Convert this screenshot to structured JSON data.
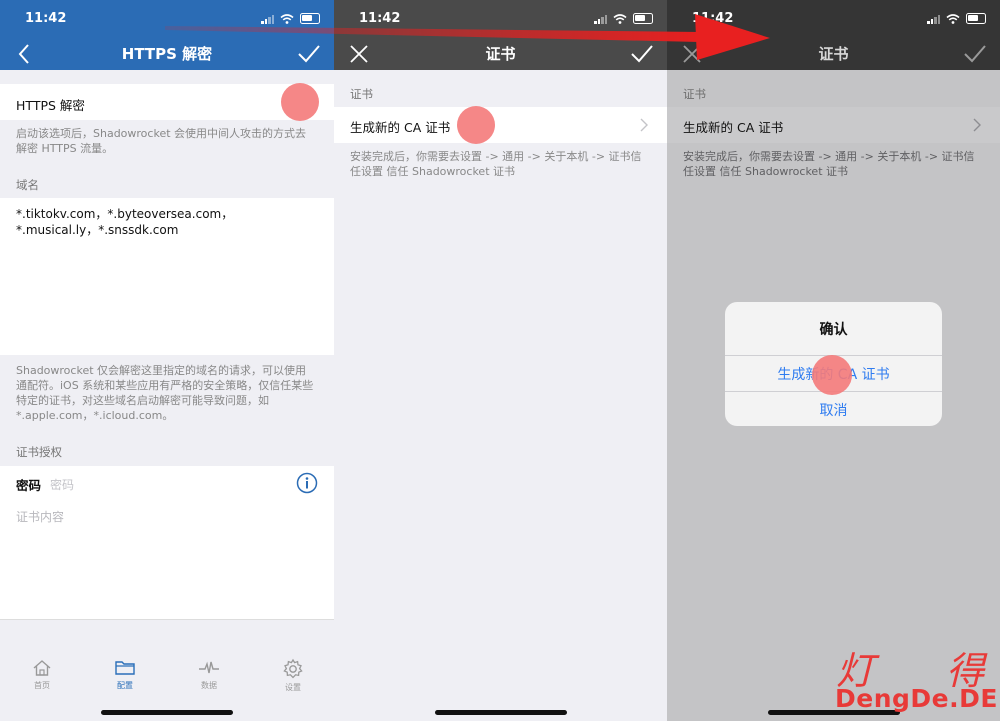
{
  "status": {
    "time_1": "11:42",
    "time_2": "11:42",
    "time_3": "11:42"
  },
  "panel1": {
    "nav_title": "HTTPS 解密",
    "https_label": "HTTPS 解密",
    "https_desc": "启动该选项后，Shadowrocket 会使用中间人攻击的方式去解密 HTTPS 流量。",
    "domain_section": "域名",
    "domain_value": "*.tiktokv.com，*.byteoversea.com，*.musical.ly，*.snssdk.com",
    "domain_note": "Shadowrocket 仅会解密这里指定的域名的请求，可以使用通配符。iOS 系统和某些应用有严格的安全策略，仅信任某些特定的证书，对这些域名启动解密可能导致问题，如 *.apple.com，*.icloud.com。",
    "cert_auth_section": "证书授权",
    "password_label": "密码",
    "password_placeholder": "密码",
    "cert_content_placeholder": "证书内容",
    "tabs": [
      {
        "label": "首页",
        "icon": "home-icon"
      },
      {
        "label": "配置",
        "icon": "folder-icon"
      },
      {
        "label": "数据",
        "icon": "pulse-icon"
      },
      {
        "label": "设置",
        "icon": "gear-icon"
      }
    ]
  },
  "panel2": {
    "nav_title": "证书",
    "section": "证书",
    "generate_label": "生成新的 CA 证书",
    "install_note": "安装完成后，你需要去设置 -> 通用 -> 关于本机 -> 证书信任设置 信任 Shadowrocket 证书"
  },
  "panel3": {
    "nav_title": "证书",
    "section": "证书",
    "generate_label": "生成新的 CA 证书",
    "install_note": "安装完成后，你需要去设置 -> 通用 -> 关于本机 -> 证书信任设置 信任 Shadowrocket 证书",
    "alert": {
      "title": "确认",
      "confirm_label": "生成新的 CA 证书",
      "cancel_label": "取消"
    }
  },
  "watermark": {
    "chinese": "灯 得",
    "domain": "DengDe.DE"
  },
  "colors": {
    "nav_blue": "#2b6cb5",
    "nav_dark": "#4a4a4a",
    "nav_dim": "#353535",
    "highlight": "#f47a7a",
    "watermark": "#e83a38",
    "link_blue": "#2f7cf0"
  }
}
